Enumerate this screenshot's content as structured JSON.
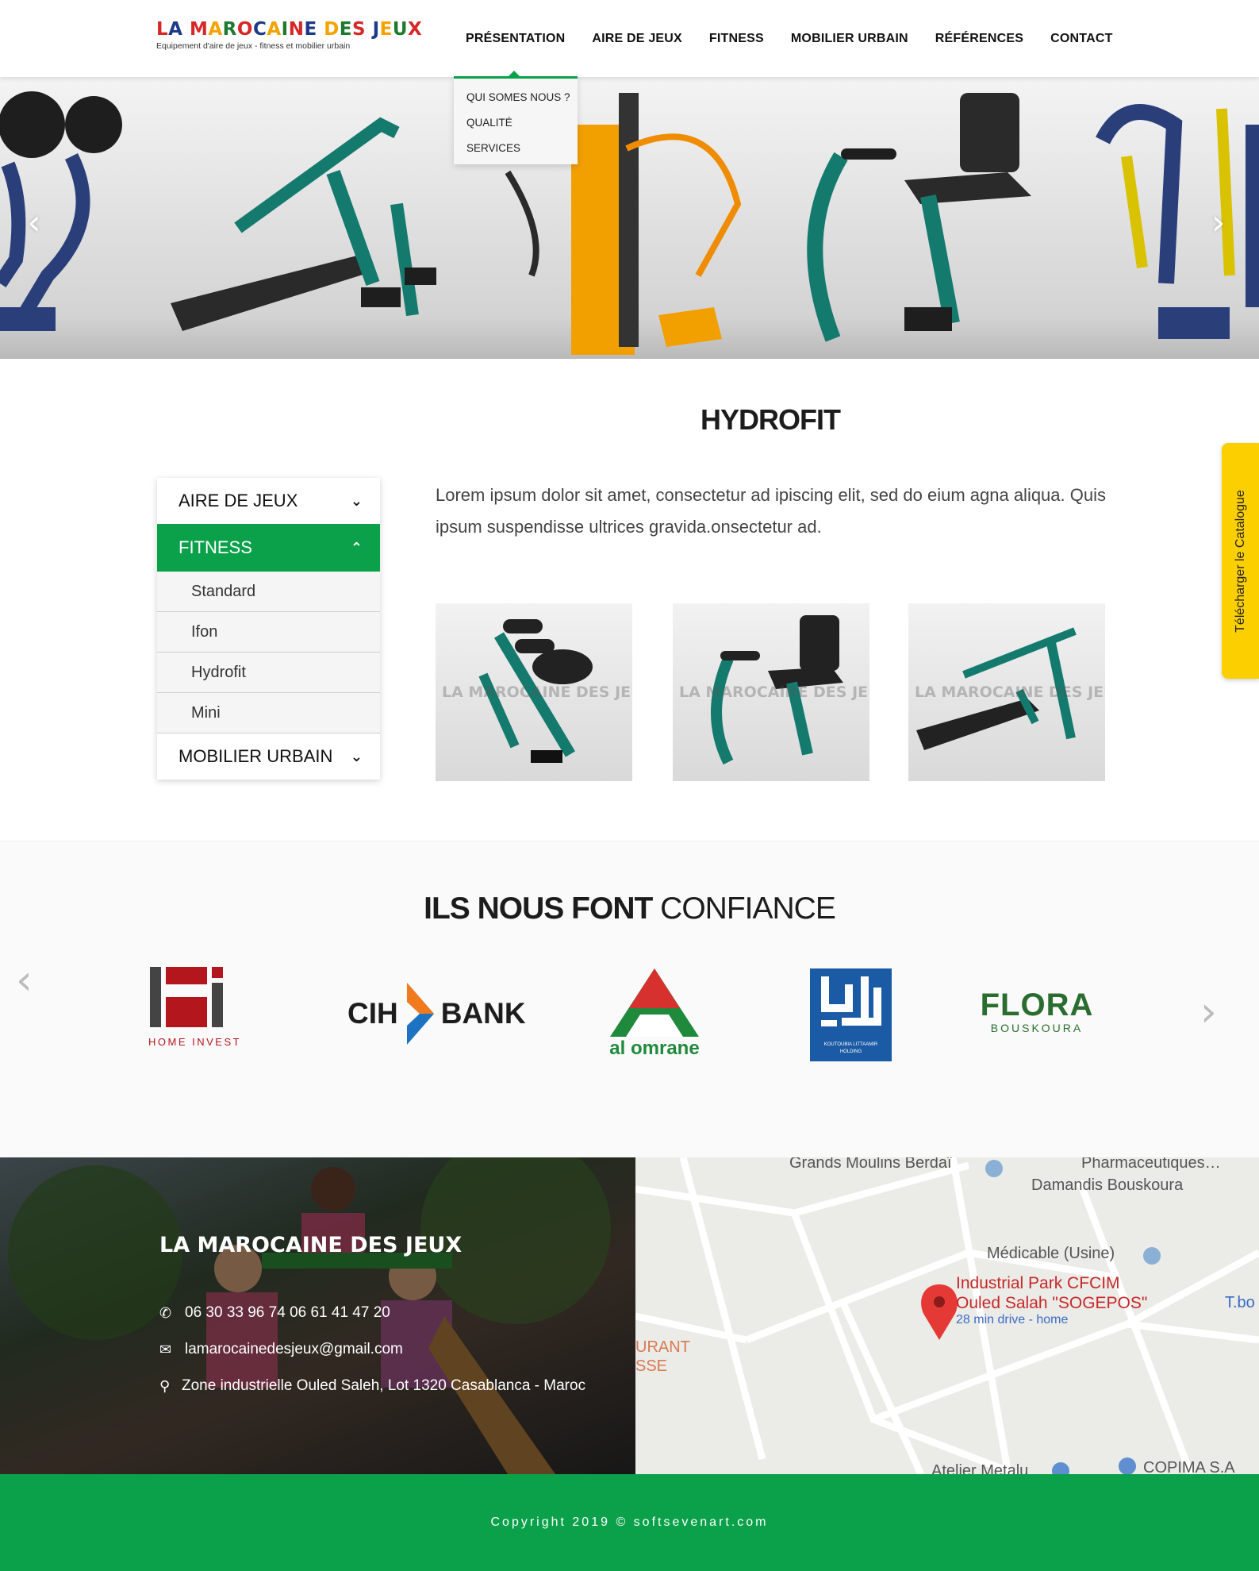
{
  "header": {
    "logo_title": "LA MAROCAINE DES JEUX",
    "logo_subtitle": "Equipement d'aire de jeux - fitness et mobilier urbain",
    "nav": [
      "PRÉSENTATION",
      "AIRE DE JEUX",
      "FITNESS",
      "MOBILIER URBAIN",
      "RÉFÉRENCES",
      "CONTACT"
    ]
  },
  "dropdown": [
    "QUI SOMES NOUS ?",
    "QUALITÉ",
    "SERVICES"
  ],
  "hero": {
    "prev_icon": "chevron-left-icon",
    "next_icon": "chevron-right-icon"
  },
  "page": {
    "title": "HYDROFIT",
    "description": "Lorem ipsum dolor sit amet, consectetur ad    ipiscing elit, sed do eium agna aliqua. Quis ipsum suspendisse ultrices gravida.onsectetur ad."
  },
  "sidebar": {
    "categories": [
      "AIRE DE JEUX",
      "FITNESS",
      "MOBILIER URBAIN"
    ],
    "fitness_items": [
      "Standard",
      "Ifon",
      "Hydrofit",
      "Mini"
    ]
  },
  "thumbs_watermark": "LA MAROCAINE DES JEUX",
  "clients": {
    "title_bold": "ILS NOUS FONT",
    "title_light": "CONFIANCE",
    "logos": {
      "home_invest": "HOME INVEST",
      "cih_left": "CIH",
      "cih_right": "BANK",
      "alomrane": "al omrane",
      "koutoubia": "KOUTOUBIA LITTAAMIR HOLDING",
      "flora": "FLORA",
      "flora_sub": "BOUSKOURA"
    }
  },
  "footer": {
    "brand": "LA MAROCAINE DES JEUX",
    "phone": "06 30 33 96 74  06 61 41 47 20",
    "email": "lamarocainedesjeux@gmail.com",
    "address": "Zone industrielle Ouled Saleh, Lot 1320  Casablanca - Maroc",
    "copyright": "Copyright 2019 © softsevenart.com"
  },
  "map": {
    "labels": [
      "Grands Moulins Berdaï",
      "Pharmaceutiques…",
      "Damandis Bouskoura",
      "Médicable (Usine)",
      "T.bo",
      "URANT",
      "SSE",
      "Atelier Metalu",
      "COPIMA S.A"
    ],
    "place_line1": "Industrial Park CFCIM",
    "place_line2": "Ouled Salah \"SOGEPOS\"",
    "place_drive": "28 min drive - home"
  },
  "catalog_label": "Télécharger le Catalogue",
  "colors": {
    "brand_green": "#0aa14a",
    "catalog_yellow": "#fcd000"
  }
}
